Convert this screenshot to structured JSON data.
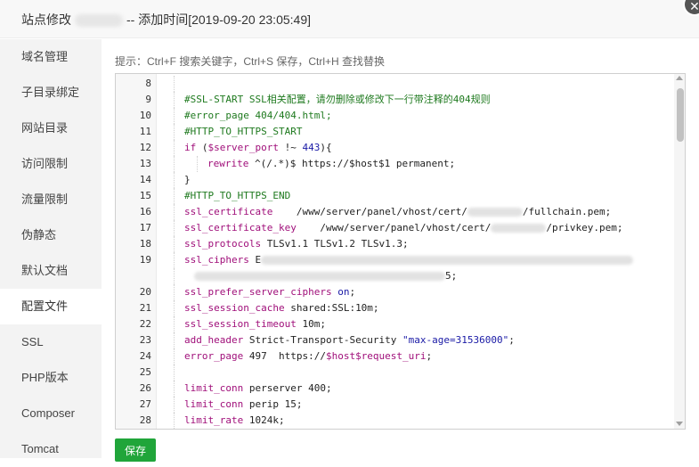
{
  "dialog": {
    "title_prefix": "站点修改",
    "title_suffix": "-- 添加时间[2019-09-20 23:05:49]",
    "close_icon": "close-icon"
  },
  "sidebar": {
    "items": [
      {
        "label": "域名管理"
      },
      {
        "label": "子目录绑定"
      },
      {
        "label": "网站目录"
      },
      {
        "label": "访问限制"
      },
      {
        "label": "流量限制"
      },
      {
        "label": "伪静态"
      },
      {
        "label": "默认文档"
      },
      {
        "label": "配置文件",
        "active": true
      },
      {
        "label": "SSL"
      },
      {
        "label": "PHP版本"
      },
      {
        "label": "Composer"
      },
      {
        "label": "Tomcat"
      }
    ]
  },
  "hint": "提示：Ctrl+F 搜索关键字，Ctrl+S 保存，Ctrl+H 查找替换",
  "editor": {
    "lines": [
      {
        "n": "8",
        "parts": []
      },
      {
        "n": "9",
        "parts": [
          {
            "t": "#SSL-START SSL相关配置，请勿删除或修改下一行带注释的404规则",
            "c": "comment"
          }
        ]
      },
      {
        "n": "10",
        "parts": [
          {
            "t": "#error_page 404/404.html;",
            "c": "comment"
          }
        ]
      },
      {
        "n": "11",
        "parts": [
          {
            "t": "#HTTP_TO_HTTPS_START",
            "c": "comment"
          }
        ]
      },
      {
        "n": "12",
        "parts": [
          {
            "t": "if",
            "c": "kw"
          },
          {
            "t": " (",
            "c": "plain"
          },
          {
            "t": "$server_port",
            "c": "var"
          },
          {
            "t": " !~ ",
            "c": "plain"
          },
          {
            "t": "443",
            "c": "str"
          },
          {
            "t": "){",
            "c": "plain"
          }
        ]
      },
      {
        "n": "13",
        "parts": [
          {
            "t": "rewrite",
            "c": "kw"
          },
          {
            "t": " ^(/.*)$ https://$host$1 permanent;",
            "c": "plain"
          }
        ]
      },
      {
        "n": "14",
        "parts": [
          {
            "t": "}",
            "c": "plain"
          }
        ]
      },
      {
        "n": "15",
        "parts": [
          {
            "t": "#HTTP_TO_HTTPS_END",
            "c": "comment"
          }
        ]
      },
      {
        "n": "16",
        "parts": [
          {
            "t": "ssl_certificate",
            "c": "kw"
          },
          {
            "t": "    /www/server/panel/vhost/cert/",
            "c": "plain"
          },
          {
            "redact": 62
          },
          {
            "t": "/fullchain.pem;",
            "c": "plain"
          }
        ]
      },
      {
        "n": "17",
        "parts": [
          {
            "t": "ssl_certificate_key",
            "c": "kw"
          },
          {
            "t": "    /www/server/panel/vhost/cert/",
            "c": "plain"
          },
          {
            "redact": 62
          },
          {
            "t": "/privkey.pem;",
            "c": "plain"
          }
        ]
      },
      {
        "n": "18",
        "parts": [
          {
            "t": "ssl_protocols",
            "c": "kw"
          },
          {
            "t": " TLSv1.1 TLSv1.2 TLSv1.3;",
            "c": "plain"
          }
        ]
      },
      {
        "n": "19",
        "parts": [
          {
            "t": "ssl_ciphers",
            "c": "kw"
          },
          {
            "t": " E",
            "c": "plain"
          },
          {
            "redact": 418
          }
        ]
      },
      {
        "n": "",
        "parts": [
          {
            "redact": 282
          },
          {
            "t": "5;",
            "c": "plain"
          }
        ]
      },
      {
        "n": "20",
        "parts": [
          {
            "t": "ssl_prefer_server_ciphers",
            "c": "kw"
          },
          {
            "t": " ",
            "c": "plain"
          },
          {
            "t": "on",
            "c": "str"
          },
          {
            "t": ";",
            "c": "plain"
          }
        ]
      },
      {
        "n": "21",
        "parts": [
          {
            "t": "ssl_session_cache",
            "c": "kw"
          },
          {
            "t": " shared:SSL:10m;",
            "c": "plain"
          }
        ]
      },
      {
        "n": "22",
        "parts": [
          {
            "t": "ssl_session_timeout",
            "c": "kw"
          },
          {
            "t": " 10m;",
            "c": "plain"
          }
        ]
      },
      {
        "n": "23",
        "parts": [
          {
            "t": "add_header",
            "c": "kw"
          },
          {
            "t": " Strict-Transport-Security ",
            "c": "plain"
          },
          {
            "t": "\"max-age=31536000\"",
            "c": "str"
          },
          {
            "t": ";",
            "c": "plain"
          }
        ]
      },
      {
        "n": "24",
        "parts": [
          {
            "t": "error_page",
            "c": "kw"
          },
          {
            "t": " 497  https://",
            "c": "plain"
          },
          {
            "t": "$host$request_uri",
            "c": "var"
          },
          {
            "t": ";",
            "c": "plain"
          }
        ]
      },
      {
        "n": "25",
        "parts": []
      },
      {
        "n": "26",
        "parts": [
          {
            "t": "limit_conn",
            "c": "kw"
          },
          {
            "t": " perserver 400;",
            "c": "plain"
          }
        ]
      },
      {
        "n": "27",
        "parts": [
          {
            "t": "limit_conn",
            "c": "kw"
          },
          {
            "t": " perip 15;",
            "c": "plain"
          }
        ]
      },
      {
        "n": "28",
        "parts": [
          {
            "t": "limit_rate",
            "c": "kw"
          },
          {
            "t": " 1024k;",
            "c": "plain"
          }
        ]
      }
    ]
  },
  "save_button": "保存",
  "colors": {
    "accent": "#20a53a",
    "comment": "#1f7a1f",
    "keyword": "#a00f7a",
    "string": "#1a1aa6"
  }
}
